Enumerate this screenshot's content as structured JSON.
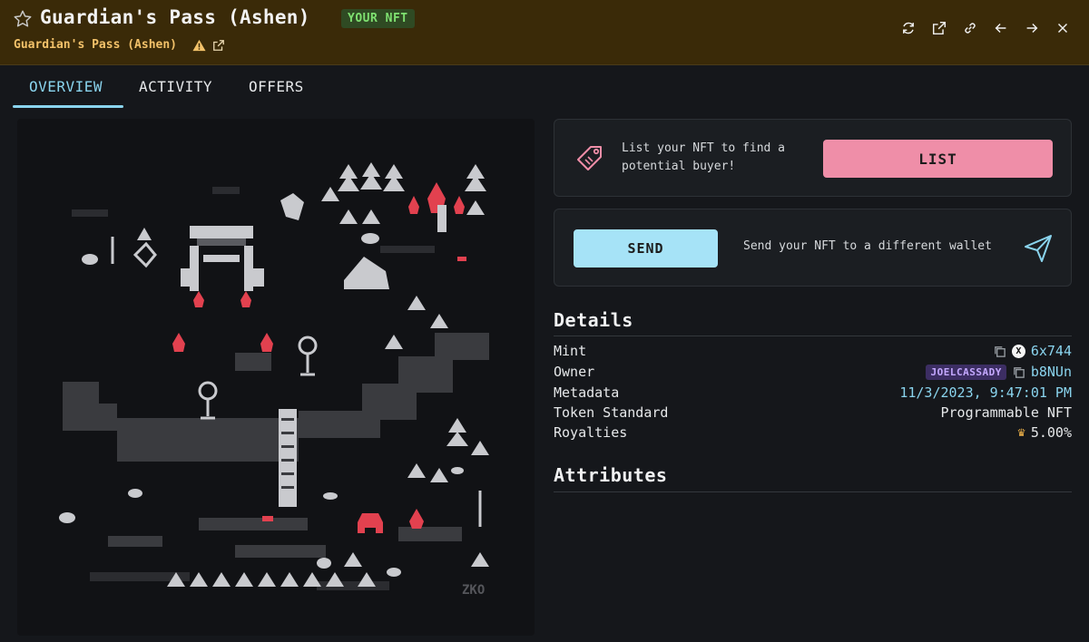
{
  "header": {
    "title": "Guardian's Pass (Ashen)",
    "badge": "YOUR NFT",
    "collection": "Guardian's Pass (Ashen)",
    "icons": [
      "refresh-icon",
      "open-external-icon",
      "link-icon",
      "arrow-left-icon",
      "arrow-right-icon",
      "close-icon"
    ]
  },
  "tabs": [
    {
      "label": "OVERVIEW",
      "active": true
    },
    {
      "label": "ACTIVITY",
      "active": false
    },
    {
      "label": "OFFERS",
      "active": false
    }
  ],
  "list_card": {
    "text": "List your NFT to find a potential buyer!",
    "button": "LIST"
  },
  "send_card": {
    "button": "SEND",
    "text": "Send your NFT to a different wallet"
  },
  "details": {
    "title": "Details",
    "rows": [
      {
        "label": "Mint",
        "value": "6x744"
      },
      {
        "label": "Owner",
        "tag": "JOELCASSADY",
        "value": "b8NUn"
      },
      {
        "label": "Metadata",
        "value": "11/3/2023, 9:47:01 PM"
      },
      {
        "label": "Token Standard",
        "value": "Programmable NFT"
      },
      {
        "label": "Royalties",
        "value": "5.00%"
      }
    ]
  },
  "attributes": {
    "title": "Attributes"
  },
  "colors": {
    "header_bg": "#3a2a08",
    "accent_blue": "#8ad4ee",
    "list_pink": "#ef8ea8",
    "send_blue": "#a6e3f7",
    "badge_green": "#7ee070",
    "fire_red": "#e2414f"
  },
  "artwork": {
    "monogram": "ZKO"
  }
}
